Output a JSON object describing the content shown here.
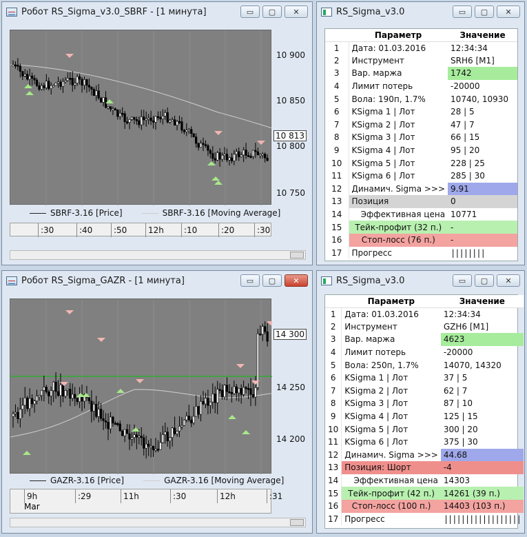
{
  "top_chart": {
    "title": "Робот RS_Sigma_v3.0_SBRF - [1 минута]",
    "y_ticks": [
      "10 900",
      "10 850",
      "10 800",
      "10 750"
    ],
    "current_price": "10 813",
    "legend": [
      "SBRF-3.16 [Price]",
      "SBRF-3.16 [Moving Average]"
    ],
    "x_ticks": [
      ":30",
      ":40",
      ":50",
      "12h",
      ":10",
      ":20",
      ":30"
    ]
  },
  "bottom_chart": {
    "title": "Робот RS_Sigma_GAZR - [1 минута]",
    "y_ticks": [
      "14 300",
      "14 250",
      "14 200"
    ],
    "current_price": "14 300",
    "legend": [
      "GAZR-3.16 [Price]",
      "GAZR-3.16 [Moving Average]"
    ],
    "x_ticks": [
      "9h",
      ":29",
      "11h",
      ":30",
      "12h",
      ":31"
    ],
    "x_sub": "Mar"
  },
  "top_table": {
    "title": "RS_Sigma_v3.0",
    "headers": [
      "Параметр",
      "Значение"
    ],
    "rows": [
      [
        "1",
        "Дата: 01.03.2016",
        "12:34:34",
        ""
      ],
      [
        "2",
        "Инструмент",
        "SRH6 [M1]",
        ""
      ],
      [
        "3",
        "Вар. маржа",
        "1742",
        "green"
      ],
      [
        "4",
        "Лимит потерь",
        "-20000",
        ""
      ],
      [
        "5",
        "Вола: 190п, 1.7%",
        "10740, 10930",
        ""
      ],
      [
        "6",
        "KSigma 1 | Лот",
        "28 | 5",
        ""
      ],
      [
        "7",
        "KSigma 2 | Лот",
        "47 | 7",
        ""
      ],
      [
        "8",
        "KSigma 3 | Лот",
        "66 | 15",
        ""
      ],
      [
        "9",
        "KSigma 4 | Лот",
        "95 | 20",
        ""
      ],
      [
        "10",
        "KSigma 5 | Лот",
        "228 | 25",
        ""
      ],
      [
        "11",
        "KSigma 6 | Лот",
        "285 | 30",
        ""
      ],
      [
        "12",
        "Динамич. Sigma >>>",
        "9.91",
        "blue"
      ],
      [
        "13",
        "Позиция",
        "0",
        "gray"
      ],
      [
        "14",
        "Эффективная цена",
        "10771",
        ""
      ],
      [
        "15",
        "Тейк-профит (32 п.)",
        "-",
        "ltgreen"
      ],
      [
        "16",
        "Стоп-лосс (76 п.)",
        "-",
        "ltred"
      ],
      [
        "17",
        "Прогресс",
        "||||||||",
        ""
      ]
    ]
  },
  "bottom_table": {
    "title": "RS_Sigma_v3.0",
    "headers": [
      "Параметр",
      "Значение"
    ],
    "rows": [
      [
        "1",
        "Дата: 01.03.2016",
        "12:34:34",
        ""
      ],
      [
        "2",
        "Инструмент",
        "GZH6 [M1]",
        ""
      ],
      [
        "3",
        "Вар. маржа",
        "4623",
        "green"
      ],
      [
        "4",
        "Лимит потерь",
        "-20000",
        ""
      ],
      [
        "5",
        "Вола: 250п, 1.7%",
        "14070, 14320",
        ""
      ],
      [
        "6",
        "KSigma 1 | Лот",
        "37 | 5",
        ""
      ],
      [
        "7",
        "KSigma 2 | Лот",
        "62 | 7",
        ""
      ],
      [
        "8",
        "KSigma 3 | Лот",
        "87 | 10",
        ""
      ],
      [
        "9",
        "KSigma 4 | Лот",
        "125 | 15",
        ""
      ],
      [
        "10",
        "KSigma 5 | Лот",
        "300 | 20",
        ""
      ],
      [
        "11",
        "KSigma 6 | Лот",
        "375 | 30",
        ""
      ],
      [
        "12",
        "Динамич. Sigma >>>",
        "44.68",
        "blue"
      ],
      [
        "13",
        "Позиция: Шорт",
        "-4",
        "red"
      ],
      [
        "14",
        "Эффективная цена",
        "14303",
        ""
      ],
      [
        "15",
        "Тейк-профит (42 п.)",
        "14261 (39 п.)",
        "ltgreen"
      ],
      [
        "16",
        "Стоп-лосс (100 п.)",
        "14403 (103 п.)",
        "ltred"
      ],
      [
        "17",
        "Прогресс",
        "||||||||||||||||||",
        ""
      ]
    ]
  }
}
